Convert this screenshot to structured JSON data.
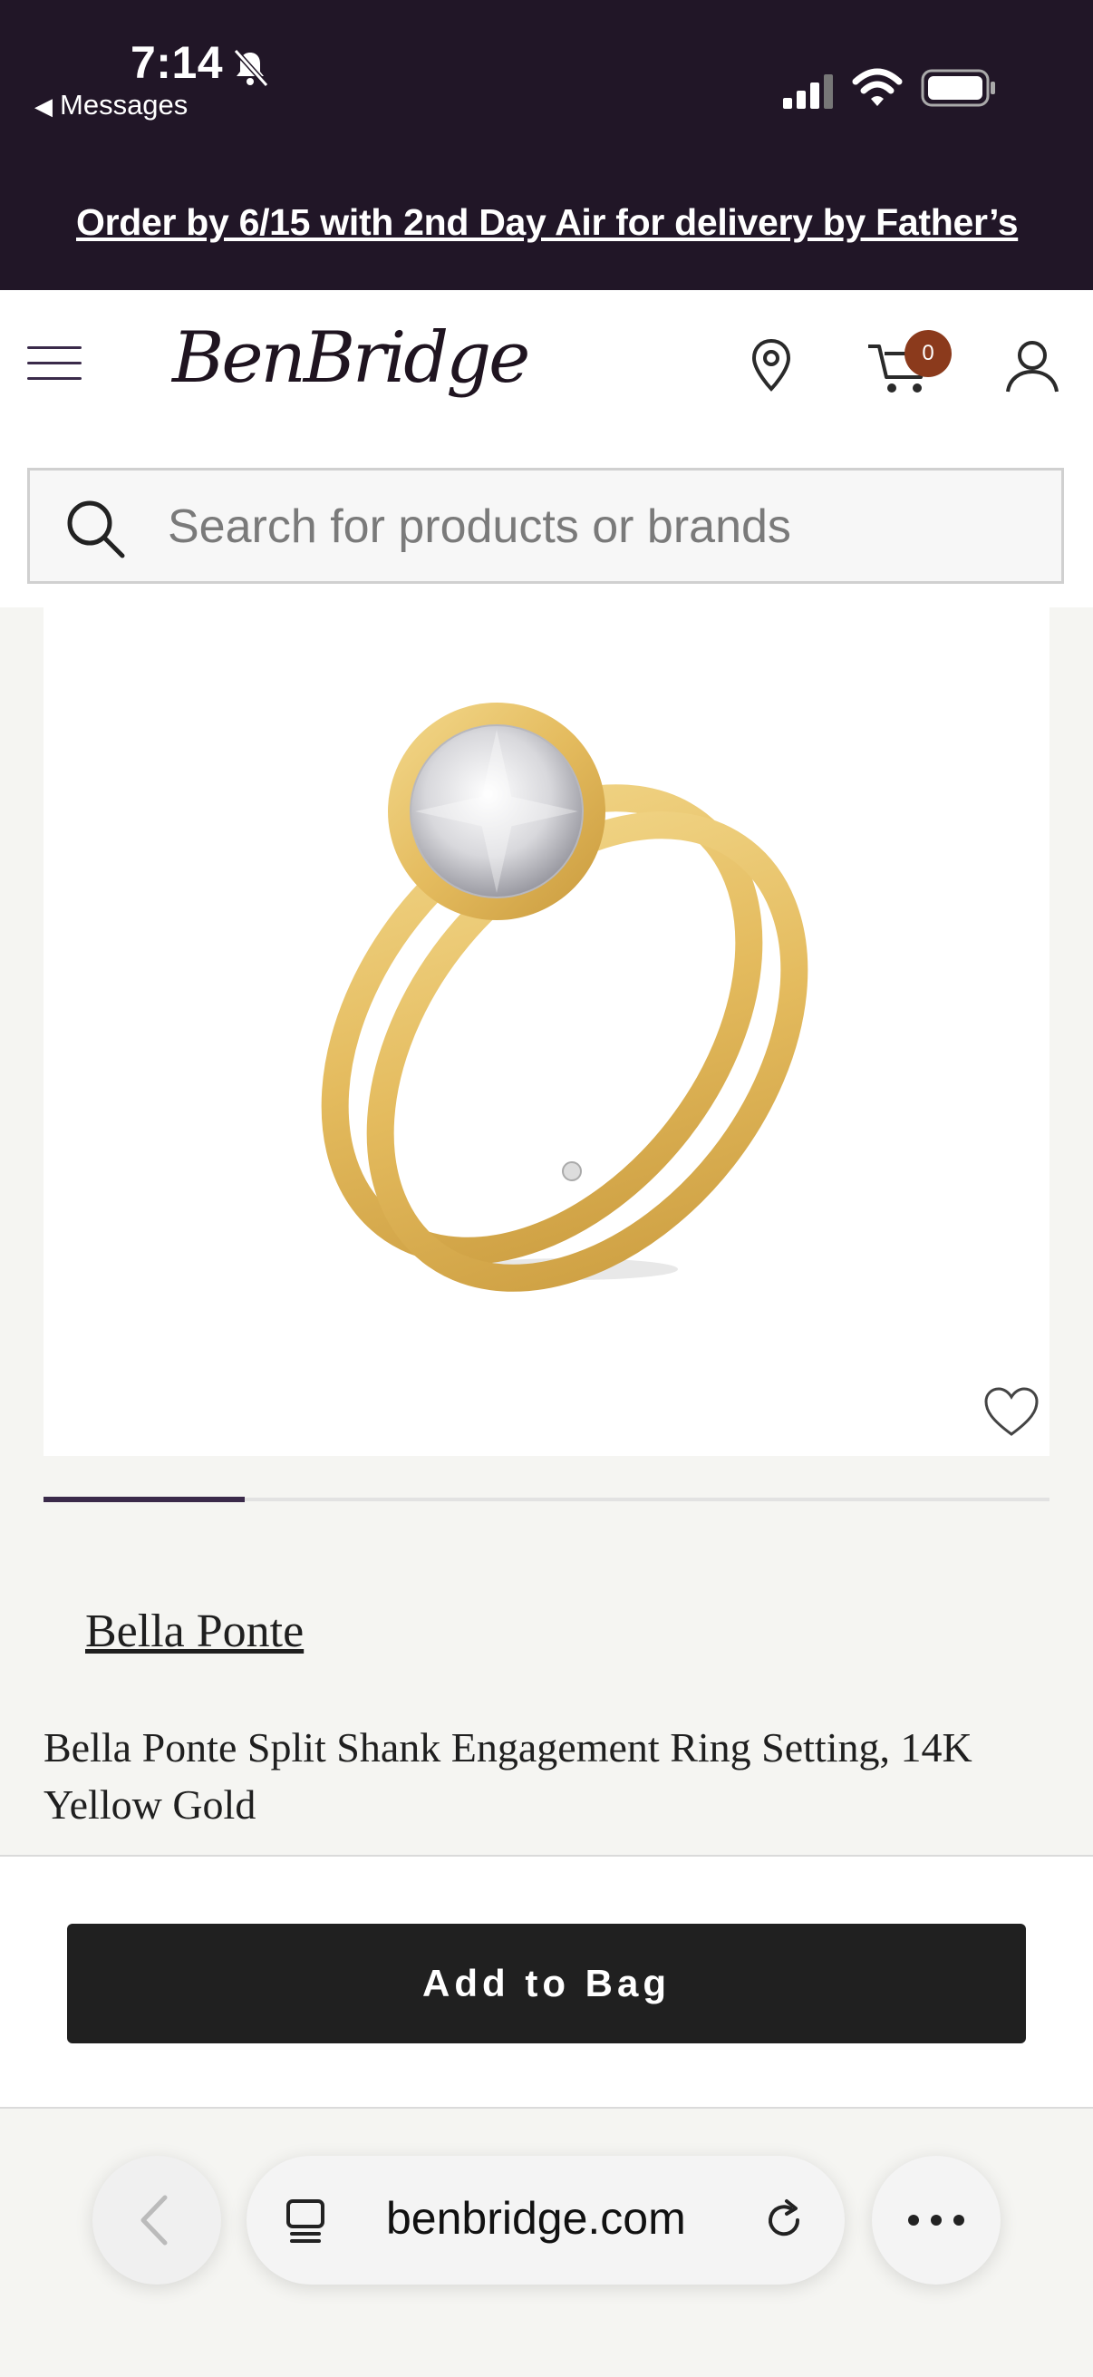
{
  "status_bar": {
    "time": "7:14",
    "back_label": "Messages"
  },
  "promo": {
    "text": "Order by 6/15 with 2nd Day Air for delivery by Father’s"
  },
  "header": {
    "logo": "BenBridge",
    "cart_count": "0",
    "brand_color": "#211627",
    "badge_color": "#8b3a1c"
  },
  "search": {
    "placeholder": "Search for products or brands"
  },
  "product": {
    "brand": "Bella Ponte",
    "title": "Bella Ponte Split Shank Engagement Ring Setting, 14K Yellow Gold",
    "carousel_position": 0.2
  },
  "actions": {
    "add_to_bag": "Add to Bag"
  },
  "browser": {
    "url": "benbridge.com"
  },
  "icons": [
    "bell-slash-icon",
    "signal-icon",
    "wifi-icon",
    "battery-icon",
    "menu-icon",
    "location-pin-icon",
    "cart-icon",
    "user-icon",
    "search-icon",
    "heart-icon",
    "chevron-left-icon",
    "tabs-icon",
    "reload-icon",
    "more-icon"
  ]
}
